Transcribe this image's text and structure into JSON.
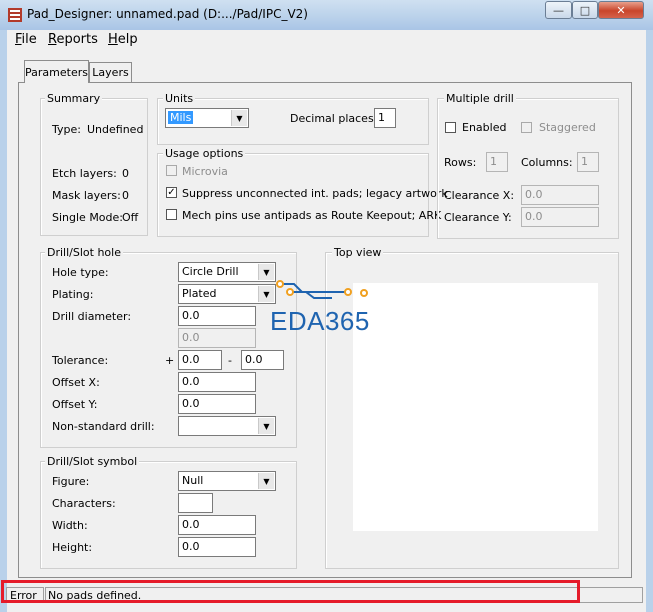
{
  "window": {
    "title": "Pad_Designer: unnamed.pad (D:.../Pad/IPC_V2)",
    "minimize": "—",
    "maximize": "□",
    "close": "✕"
  },
  "menu": {
    "file_first": "F",
    "file_rest": "ile",
    "reports_first": "R",
    "reports_rest": "eports",
    "help_first": "H",
    "help_rest": "elp"
  },
  "tabs": [
    "Parameters",
    "Layers"
  ],
  "summary": {
    "legend": "Summary",
    "type_label": "Type:",
    "type_value": "Undefined",
    "etch_label": "Etch layers:",
    "etch_value": "0",
    "mask_label": "Mask layers:",
    "mask_value": "0",
    "single_label": "Single Mode:",
    "single_value": "Off"
  },
  "units": {
    "legend": "Units",
    "selected": "Mils",
    "decimal_label": "Decimal places:",
    "decimal_value": "1"
  },
  "usage": {
    "legend": "Usage options",
    "microvia": "Microvia",
    "suppress": "Suppress unconnected int. pads; legacy artwork",
    "suppress_checked": "✓",
    "mech": "Mech pins use antipads as Route Keepout; ARK"
  },
  "multiple_drill": {
    "legend": "Multiple drill",
    "enabled": "Enabled",
    "staggered": "Staggered",
    "rows_label": "Rows:",
    "rows_value": "1",
    "columns_label": "Columns:",
    "columns_value": "1",
    "clearance_x_label": "Clearance X:",
    "clearance_x_value": "0.0",
    "clearance_y_label": "Clearance Y:",
    "clearance_y_value": "0.0"
  },
  "drill_hole": {
    "legend": "Drill/Slot hole",
    "hole_type_label": "Hole type:",
    "hole_type_value": "Circle Drill",
    "plating_label": "Plating:",
    "plating_value": "Plated",
    "diameter_label": "Drill diameter:",
    "diameter_value": "0.0",
    "diameter_value2": "0.0",
    "tolerance_label": "Tolerance:",
    "tol_plus": "+",
    "tol_plus_value": "0.0",
    "tol_minus": "-",
    "tol_minus_value": "0.0",
    "offset_x_label": "Offset X:",
    "offset_x_value": "0.0",
    "offset_y_label": "Offset Y:",
    "offset_y_value": "0.0",
    "nonstd_label": "Non-standard drill:",
    "nonstd_value": ""
  },
  "drill_symbol": {
    "legend": "Drill/Slot symbol",
    "figure_label": "Figure:",
    "figure_value": "Null",
    "characters_label": "Characters:",
    "characters_value": "",
    "width_label": "Width:",
    "width_value": "0.0",
    "height_label": "Height:",
    "height_value": "0.0"
  },
  "top_view": {
    "legend": "Top view"
  },
  "watermark": {
    "text": "EDA365"
  },
  "status": {
    "label": "Error",
    "message": "No pads defined."
  },
  "colors": {
    "highlight": "#e51b2a",
    "watermark_blue": "#1f64b0",
    "watermark_orange": "#f0a020",
    "selection": "#3399ff"
  }
}
